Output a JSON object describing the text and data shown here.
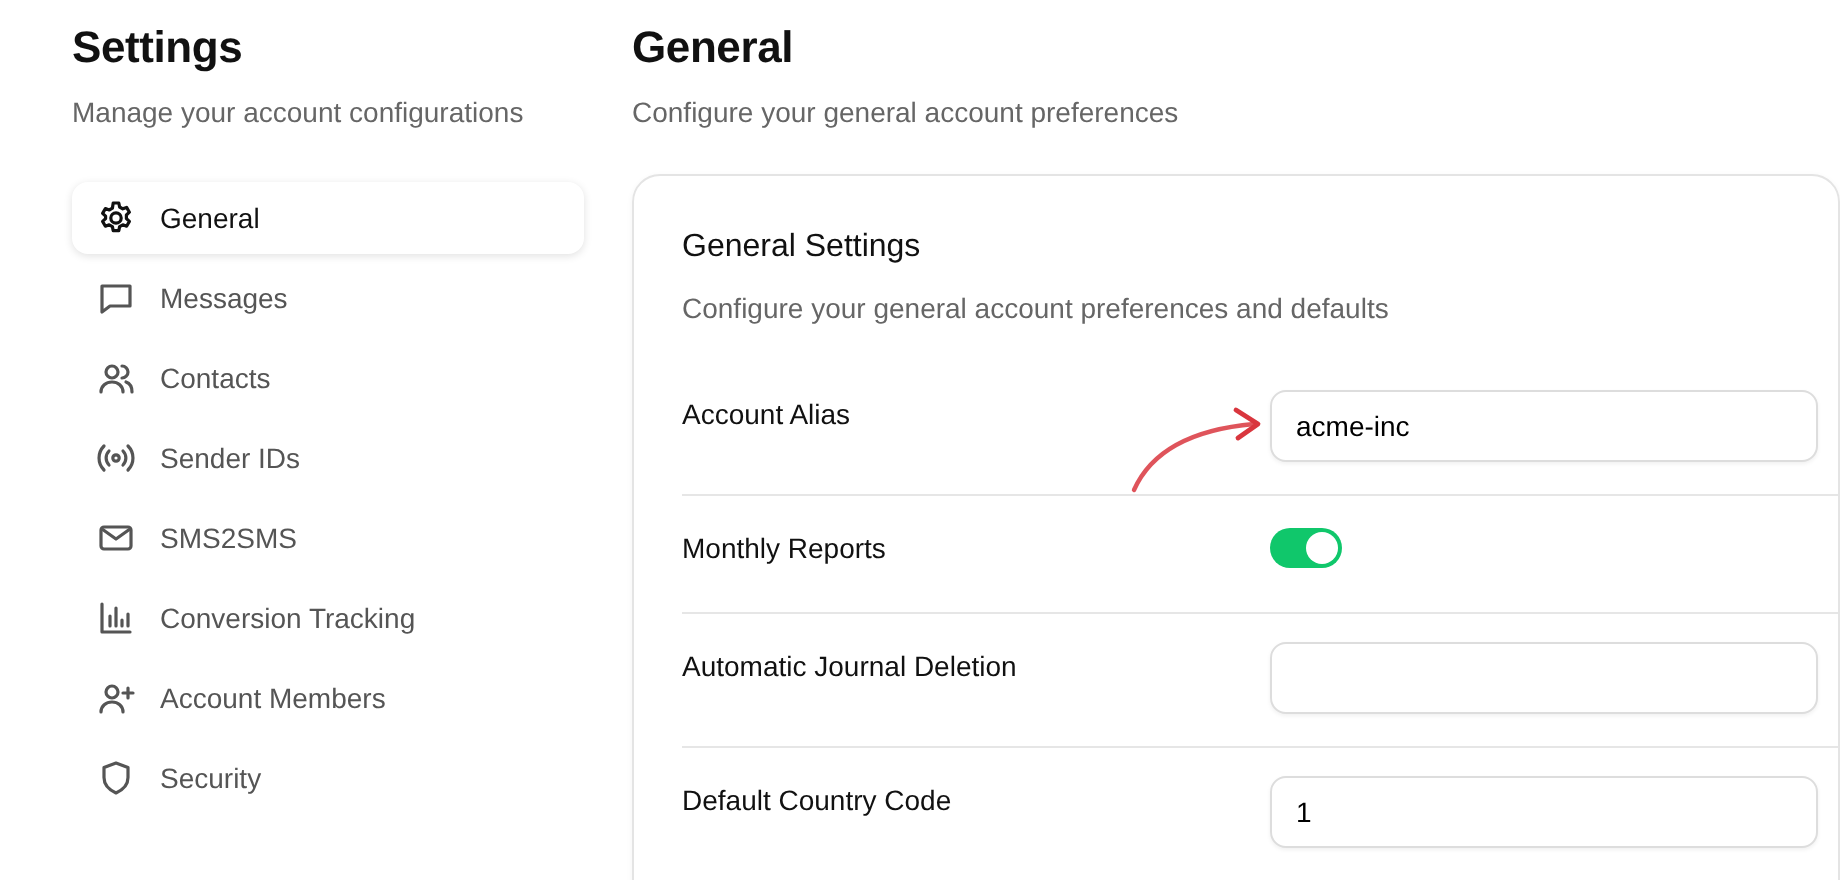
{
  "sidebar": {
    "title": "Settings",
    "subtitle": "Manage your account configurations",
    "items": [
      {
        "label": "General",
        "selected": true
      },
      {
        "label": "Messages",
        "selected": false
      },
      {
        "label": "Contacts",
        "selected": false
      },
      {
        "label": "Sender IDs",
        "selected": false
      },
      {
        "label": "SMS2SMS",
        "selected": false
      },
      {
        "label": "Conversion Tracking",
        "selected": false
      },
      {
        "label": "Account Members",
        "selected": false
      },
      {
        "label": "Security",
        "selected": false
      }
    ]
  },
  "main": {
    "title": "General",
    "subtitle": "Configure your general account preferences",
    "card": {
      "title": "General Settings",
      "subtitle": "Configure your general account preferences and defaults",
      "settings": [
        {
          "label": "Account Alias",
          "kind": "input",
          "value": "acme-inc",
          "annotated": true
        },
        {
          "label": "Monthly Reports",
          "kind": "toggle",
          "on": true
        },
        {
          "label": "Automatic Journal Deletion",
          "kind": "input"
        },
        {
          "label": "Default Country Code",
          "kind": "input",
          "value": "1"
        }
      ]
    }
  }
}
